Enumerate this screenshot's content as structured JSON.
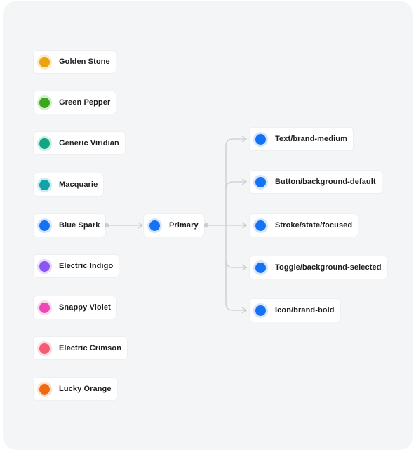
{
  "palette": [
    {
      "label": "Golden Stone",
      "color": "#E9A30F",
      "ring": "#FCEBCB",
      "icon": "color-swatch"
    },
    {
      "label": "Green Pepper",
      "color": "#3BA71C",
      "ring": "#D6EECE",
      "icon": "color-swatch"
    },
    {
      "label": "Generic Viridian",
      "color": "#11A584",
      "ring": "#CCEDE3",
      "icon": "color-swatch"
    },
    {
      "label": "Macquarie",
      "color": "#11A3A9",
      "ring": "#CCECEE",
      "icon": "color-swatch"
    },
    {
      "label": "Blue Spark",
      "color": "#1472F5",
      "ring": "#D5E5FD",
      "icon": "color-swatch"
    },
    {
      "label": "Electric Indigo",
      "color": "#8A55F4",
      "ring": "#E5D9FC",
      "icon": "color-swatch"
    },
    {
      "label": "Snappy Violet",
      "color": "#EE48B6",
      "ring": "#FCD9EE",
      "icon": "color-swatch"
    },
    {
      "label": "Electric Crimson",
      "color": "#F55B77",
      "ring": "#FDDBE1",
      "icon": "color-swatch"
    },
    {
      "label": "Lucky Orange",
      "color": "#EF6A12",
      "ring": "#FCDFCC",
      "icon": "color-swatch"
    }
  ],
  "primary": {
    "label": "Primary",
    "color": "#1472F5",
    "ring": "#D5E5FD",
    "icon": "color-swatch"
  },
  "tokens": [
    {
      "label": "Text/brand-medium",
      "color": "#1472F5",
      "ring": "#D5E5FD",
      "icon": "color-swatch"
    },
    {
      "label": "Button/background-default",
      "color": "#1472F5",
      "ring": "#D5E5FD",
      "icon": "color-swatch"
    },
    {
      "label": "Stroke/state/focused",
      "color": "#1472F5",
      "ring": "#D5E5FD",
      "icon": "color-swatch"
    },
    {
      "label": "Toggle/background-selected",
      "color": "#1472F5",
      "ring": "#D5E5FD",
      "icon": "color-swatch"
    },
    {
      "label": "Icon/brand-bold",
      "color": "#1472F5",
      "ring": "#D5E5FD",
      "icon": "color-swatch"
    }
  ],
  "connectors": {
    "line_color": "#C9CDD2",
    "node_color": "#C9CDD2"
  }
}
